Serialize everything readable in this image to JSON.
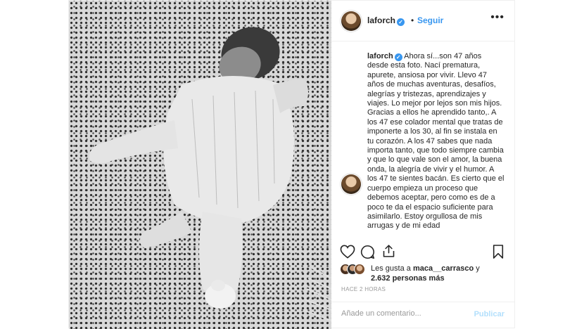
{
  "post": {
    "header": {
      "username": "laforch",
      "verified_icon": "verified-badge-icon",
      "separator": "•",
      "follow_label": "Seguir",
      "more_icon": "ellipsis-icon",
      "more_label": "•••"
    },
    "photo": {
      "alt": "Foto en blanco y negro de un bebé con chaleco tejido sobre una manta de encaje"
    },
    "caption": {
      "username": "laforch",
      "text": "Ahora sí...son 47 años desde esta foto. Nací prematura, apurete, ansiosa por vivir. Llevo 47 años de muchas aventuras, desafíos, alegrías y tristezas, aprendizajes y viajes. Lo mejor por lejos son mis hijos. Gracias a ellos he aprendido tanto,. A los 47 ese colador mental que tratas de imponerte a los 30, al fin se instala en tu corazón. A los 47 sabes que nada importa tanto, que todo siempre cambia y que lo que vale son el amor, la buena onda, la alegría de vivir y el humor. A los 47 te sientes bacán. Es cierto que el cuerpo empieza un proceso que debemos aceptar, pero como es de a poco te da el espacio suficiente para asimilarlo. Estoy orgullosa de mis arrugas y de mi edad"
    },
    "actions": {
      "like_icon": "heart-icon",
      "comment_icon": "comment-icon",
      "share_icon": "share-icon",
      "save_icon": "bookmark-icon"
    },
    "likes": {
      "prefix": "Les gusta a ",
      "user": "maca__carrasco",
      "connector": " y",
      "count": "2.632 personas más"
    },
    "timestamp": "HACE 2 HORAS",
    "comment": {
      "placeholder": "Añade un comentario...",
      "publish_label": "Publicar"
    },
    "colors": {
      "link": "#3897f0",
      "publish_disabled": "#b2dffc",
      "muted": "#999999",
      "text": "#262626"
    }
  }
}
